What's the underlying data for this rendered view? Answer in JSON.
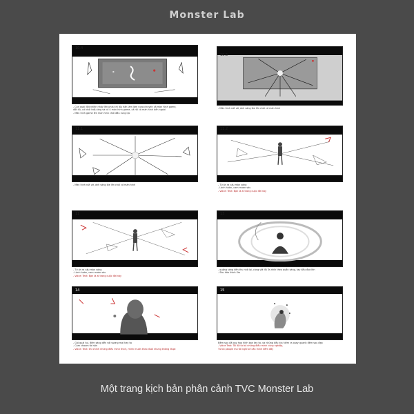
{
  "header": {
    "logo_text": "Monster Lab"
  },
  "caption": "Một trang kịch bản phân cảnh TVC Monster Lab",
  "panels": [
    {
      "number": "10.4",
      "lines": [
        "- Con quái đột nhiên nhảy lên phía khi lấu hắn làm làm rung chuyển cả màn hình game,",
        "đốt đủ, cả khói hiệu ứng và có 4 màn hình game, cả rồi cả màn hình bên ngoài",
        "- Màn hình game lên màn hình chói đầu rung lực"
      ],
      "notes": []
    },
    {
      "number": "10.5",
      "lines": [
        "- Màn hình nứt vỡ, ánh sáng lóe lên chói cả màn hình"
      ],
      "notes": []
    },
    {
      "number": "11.1",
      "lines": [
        "- Màn hình nứt vỡ, ánh sáng lóe lên chói cả màn hình"
      ],
      "notes": []
    },
    {
      "number": "11.2",
      "lines": [
        "- Từ ẩn ra cậu màn sáng",
        "- Lành hoàn, cam mươn sáu"
      ],
      "notes": [
        "- Voice: Text: Bạn là ai trong cuộc đời này"
      ]
    },
    {
      "number": "11",
      "lines": [
        "- Từ ẩn ra cậu màn sáng",
        "- Lành hoàn, cam mươn sáu"
      ],
      "notes": [
        "- Voice: Text: Bạn là ai trong cuộc đời này"
      ]
    },
    {
      "number": "13",
      "lines": [
        "- quặng sáng đến thu nhờ lại, càng với đủ 3s nhìn theo quần sáng, tay đầu đưa lên",
        "- Sáu hảo thích lửa"
      ],
      "notes": []
    },
    {
      "number": "14",
      "lines": [
        "- Gió quái tui, đêm sáng đến với sương mai hay ta",
        "- Cam choom tài sản"
      ],
      "notes": [
        "- Voice: Text: khi chính những điều mình thích, mình muốn theo đuổi nhưng không được"
      ]
    },
    {
      "number": "15",
      "lines": [
        "Đêm sau đã bay hao hiến ban tay ta, và những đêu kia hiểm ra xoay quanh đêm sau đẹp"
      ],
      "notes": [
        "- Voice Text: Tôi đã từ bỏ những điều mình cùng nghiệp,",
        "            Từ bỏ people mà tôi nghĩ sẽ cần mình đêm đầy"
      ]
    }
  ]
}
